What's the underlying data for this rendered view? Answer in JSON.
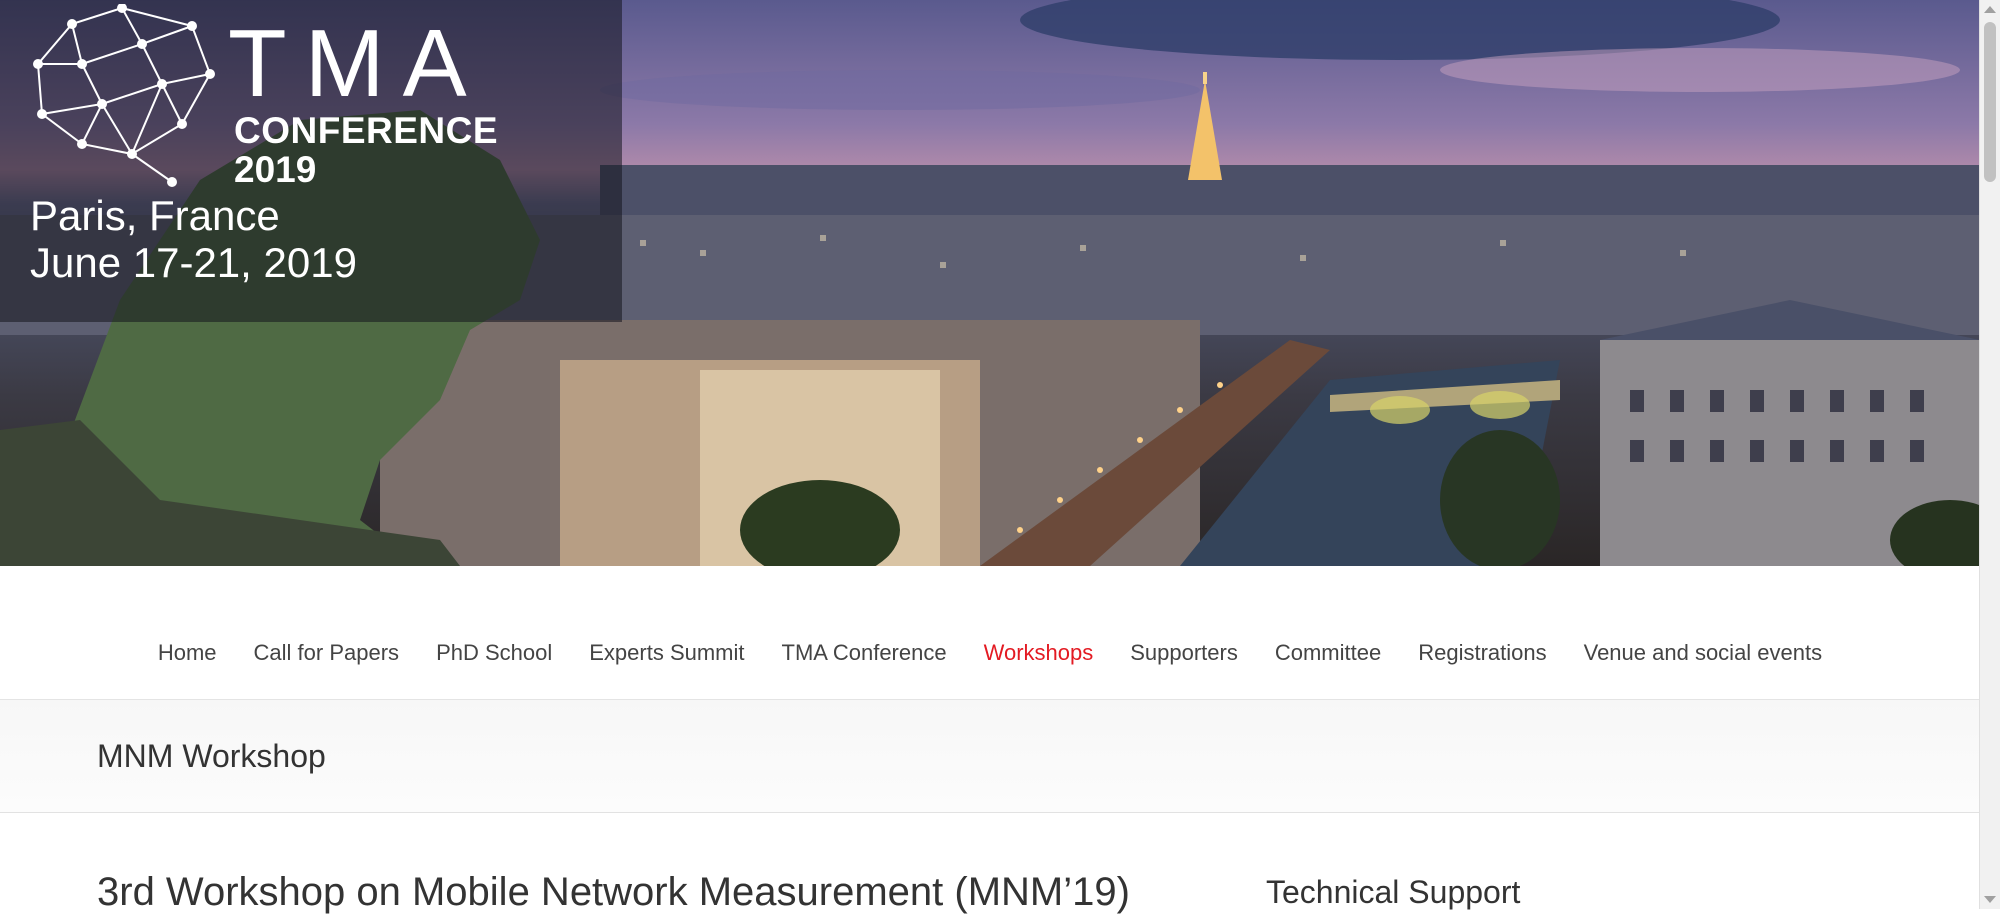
{
  "banner": {
    "logo_tma": "TMA",
    "logo_conference": "CONFERENCE",
    "logo_year": "2019",
    "location": "Paris, France",
    "dates": "June 17-21, 2019"
  },
  "nav": {
    "items": [
      {
        "label": "Home",
        "active": false
      },
      {
        "label": "Call for Papers",
        "active": false
      },
      {
        "label": "PhD School",
        "active": false
      },
      {
        "label": "Experts Summit",
        "active": false
      },
      {
        "label": "TMA Conference",
        "active": false
      },
      {
        "label": "Workshops",
        "active": true
      },
      {
        "label": "Supporters",
        "active": false
      },
      {
        "label": "Committee",
        "active": false
      },
      {
        "label": "Registrations",
        "active": false
      },
      {
        "label": "Venue and social events",
        "active": false
      }
    ],
    "active_color": "#e31b23"
  },
  "page": {
    "title": "MNM Workshop"
  },
  "content": {
    "heading": "3rd Workshop on Mobile Network Measurement (MNM’19)"
  },
  "sidebar": {
    "heading": "Technical Support"
  }
}
